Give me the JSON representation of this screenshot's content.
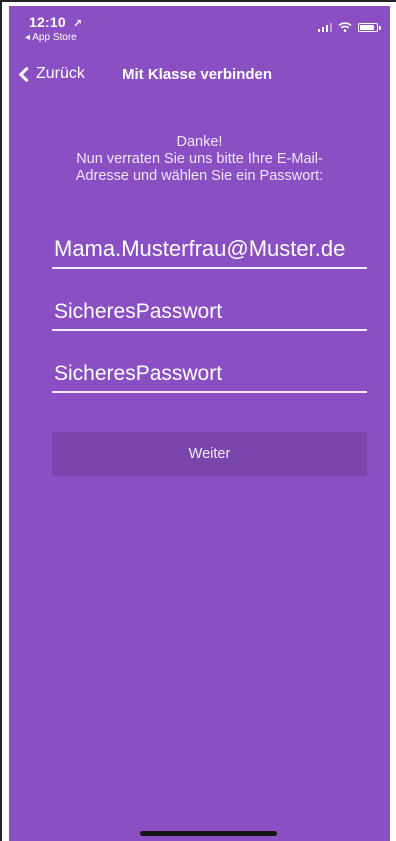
{
  "status_bar": {
    "time": "12:10",
    "location_arrow": "➤",
    "back_to_app": "◂ App Store"
  },
  "nav": {
    "back_label": "Zurück",
    "title": "Mit Klasse verbinden"
  },
  "intro": {
    "line1": "Danke!",
    "line2": "Nun verraten Sie uns bitte Ihre E-Mail-",
    "line3": "Adresse und wählen Sie ein Passwort:"
  },
  "form": {
    "email_value": "Mama.Musterfrau@Muster.de",
    "password_value": "SicheresPasswort",
    "password_confirm_value": "SicheresPasswort",
    "continue_label": "Weiter"
  },
  "colors": {
    "background": "#8a4fc2",
    "button": "#7a45ad",
    "text": "#ffffff"
  }
}
